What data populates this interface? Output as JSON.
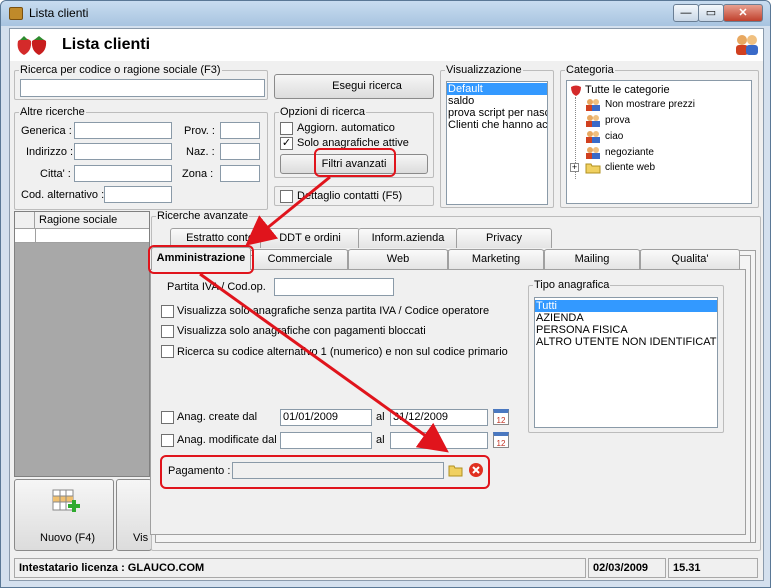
{
  "window": {
    "title": "Lista clienti",
    "minimize": "—",
    "maximize": "▭",
    "close": "✕"
  },
  "header": {
    "title": "Lista clienti"
  },
  "search": {
    "group_label": "Ricerca per codice o ragione sociale (F3)",
    "value": "",
    "run_label": "Esegui ricerca"
  },
  "altre": {
    "group_label": "Altre ricerche",
    "generica": "Generica :",
    "indirizzo": "Indirizzo :",
    "citta": "Citta' :",
    "cod_alt": "Cod. alternativo :",
    "prov": "Prov. :",
    "naz": "Naz. :",
    "zona": "Zona :"
  },
  "opzioni": {
    "group_label": "Opzioni di ricerca",
    "aggiorn": "Aggiorn. automatico",
    "solo_attive": "Solo anagrafiche attive",
    "filtri": "Filtri avanzati",
    "dettaglio": "Dettaglio contatti (F5)",
    "check_mark": "✓"
  },
  "visualizzazione": {
    "group_label": "Visualizzazione",
    "items": [
      "Default",
      "saldo",
      "prova script per nasc",
      "Clienti che hanno acc"
    ]
  },
  "categoria": {
    "group_label": "Categoria",
    "root": "Tutte le categorie",
    "items": [
      "Non mostrare prezzi",
      "prova",
      "ciao",
      "negoziante",
      "cliente web"
    ],
    "expand": "+"
  },
  "grid": {
    "column": "Ragione sociale"
  },
  "ricerche_avanzate": {
    "label": "Ricerche avanzate"
  },
  "tabs_back": [
    "Estratto conto",
    "DDT e ordini",
    "Inform.azienda",
    "Privacy"
  ],
  "tabs_front": [
    "Amministrazione",
    "Commerciale",
    "Web",
    "Marketing",
    "Mailing",
    "Qualita'"
  ],
  "admin": {
    "piva_label": "Partita IVA / Cod.op.",
    "chk1": "Visualizza solo anagrafiche senza partita IVA / Codice operatore",
    "chk2": "Visualizza solo anagrafiche con pagamenti bloccati",
    "chk3": "Ricerca su codice alternativo 1 (numerico)  e non sul codice primario",
    "create_label": "Anag. create dal",
    "create_from": "01/01/2009",
    "al": "al",
    "create_to": "31/12/2009",
    "mod_label": "Anag. modificate dal",
    "mod_from": "",
    "mod_to": "",
    "pagamento_label": "Pagamento :",
    "pagamento_value": "",
    "cal_icon": "12"
  },
  "tipo": {
    "group_label": "Tipo anagrafica",
    "items": [
      "Tutti",
      "AZIENDA",
      "PERSONA FISICA",
      "ALTRO UTENTE NON IDENTIFICAT"
    ]
  },
  "bottom": {
    "nuovo": "Nuovo (F4)",
    "vis": "Vis"
  },
  "status": {
    "licenza": "Intestatario licenza : GLAUCO.COM",
    "date": "02/03/2009",
    "time": "15.31"
  },
  "colors": {
    "annotation_red": "#e0141c",
    "selection": "#3399ff"
  }
}
